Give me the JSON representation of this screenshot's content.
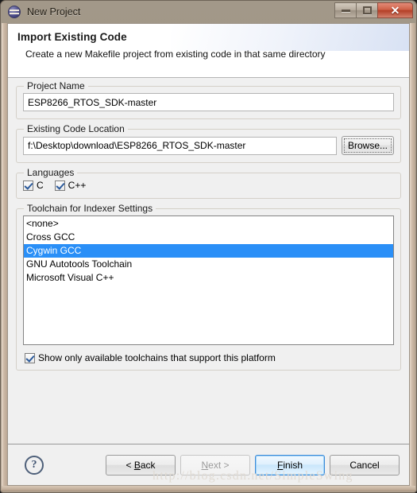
{
  "window": {
    "title": "New Project",
    "icon": "eclipse-wizard-icon",
    "controls": {
      "minimize": "minimize-icon",
      "restore": "restore-icon",
      "close": "close-icon",
      "close_glyph": "✕"
    }
  },
  "header": {
    "title": "Import Existing Code",
    "description": "Create a new Makefile project from existing code in that same directory"
  },
  "project_name": {
    "group_label": "Project Name",
    "value": "ESP8266_RTOS_SDK-master",
    "placeholder": ""
  },
  "existing_code_location": {
    "group_label": "Existing Code Location",
    "value": "f:\\Desktop\\download\\ESP8266_RTOS_SDK-master",
    "placeholder": "",
    "browse_label": "Browse..."
  },
  "languages": {
    "group_label": "Languages",
    "options": [
      {
        "label": "C",
        "checked": true
      },
      {
        "label": "C++",
        "checked": true
      }
    ]
  },
  "toolchain": {
    "group_label": "Toolchain for Indexer Settings",
    "items": [
      {
        "label": "<none>",
        "selected": false
      },
      {
        "label": "Cross GCC",
        "selected": false
      },
      {
        "label": "Cygwin GCC",
        "selected": true
      },
      {
        "label": "GNU Autotools Toolchain",
        "selected": false
      },
      {
        "label": "Microsoft Visual C++",
        "selected": false
      }
    ],
    "selection_color": "#2a8ff7",
    "show_only_available": {
      "label": "Show only available toolchains that support this platform",
      "checked": true
    }
  },
  "buttonbar": {
    "help_label": "?",
    "back": {
      "prefix": "< ",
      "accel": "B",
      "rest": "ack",
      "disabled": false
    },
    "next": {
      "accel": "N",
      "rest": "ext",
      "suffix": " >",
      "disabled": true
    },
    "finish": {
      "accel": "F",
      "rest": "inish",
      "disabled": false,
      "is_default": true
    },
    "cancel": {
      "label": "Cancel",
      "disabled": false
    }
  },
  "watermark": "http://blog.csdn.net/SimpleSwing"
}
